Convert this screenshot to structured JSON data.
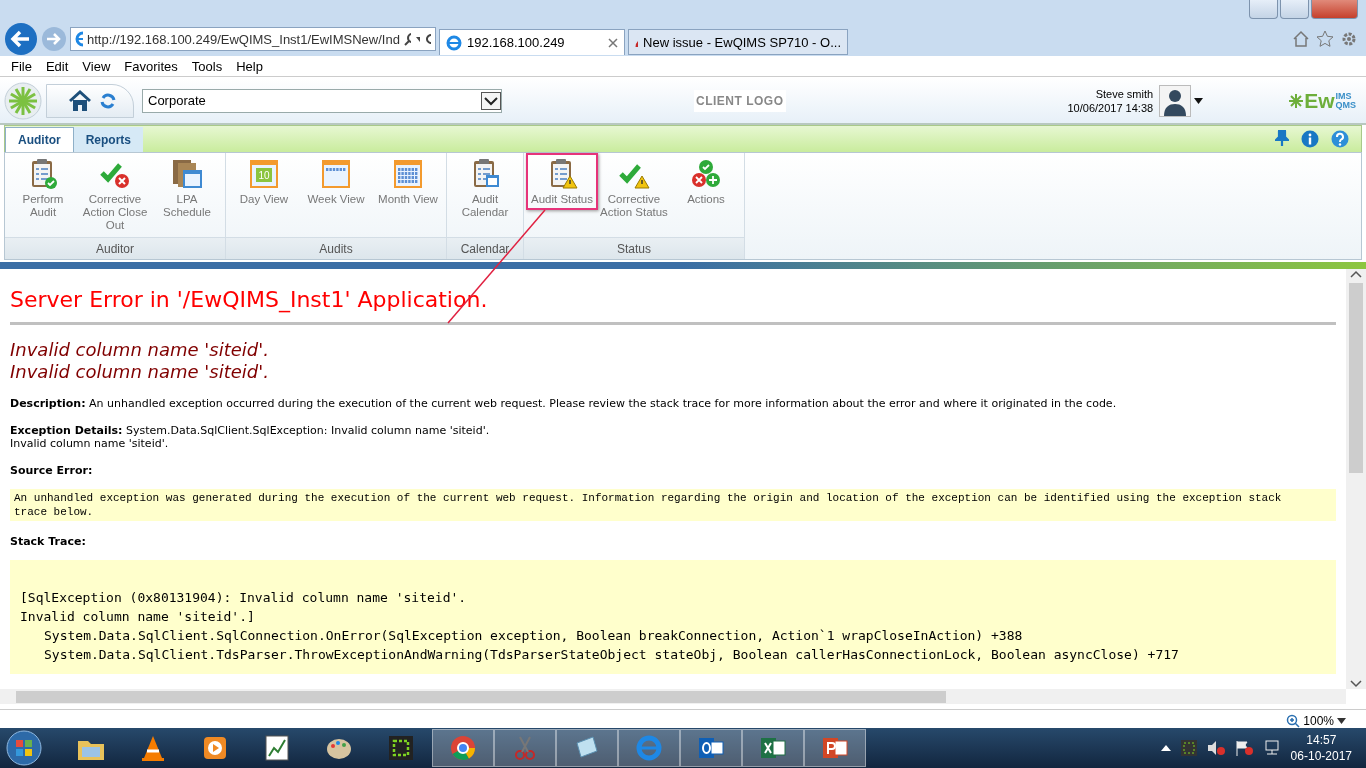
{
  "browser": {
    "address": "http://192.168.100.249/EwQIMS_Inst1/EwIMSNew/Ind",
    "tabs": [
      {
        "label": "192.168.100.249",
        "selected": true
      },
      {
        "label": "New issue - EwQIMS SP710 - O...",
        "selected": false
      }
    ],
    "menu": [
      "File",
      "Edit",
      "View",
      "Favorites",
      "Tools",
      "Help"
    ]
  },
  "app_header": {
    "site": "Corporate",
    "client_logo": "CLIENT LOGO",
    "user": "Steve smith",
    "datetime": "10/06/2017 14:38",
    "brand": {
      "main": "Ew",
      "top": "IMS",
      "bottom": "QMS"
    }
  },
  "ribbon": {
    "tabs": [
      {
        "label": "Auditor",
        "selected": true
      },
      {
        "label": "Reports",
        "selected": false
      }
    ],
    "groups": [
      {
        "label": "Auditor",
        "buttons": [
          {
            "label": "Perform Audit",
            "highlighted": false
          },
          {
            "label": "Corrective Action Close Out",
            "highlighted": false
          },
          {
            "label": "LPA Schedule",
            "highlighted": false
          }
        ]
      },
      {
        "label": "Audits",
        "buttons": [
          {
            "label": "Day View",
            "highlighted": false,
            "badge": "10"
          },
          {
            "label": "Week View",
            "highlighted": false
          },
          {
            "label": "Month View",
            "highlighted": false
          }
        ]
      },
      {
        "label": "Calendar",
        "buttons": [
          {
            "label": "Audit Calendar",
            "highlighted": false
          }
        ]
      },
      {
        "label": "Status",
        "buttons": [
          {
            "label": "Audit Status",
            "highlighted": true
          },
          {
            "label": "Corrective Action Status",
            "highlighted": false
          },
          {
            "label": "Actions",
            "highlighted": false
          }
        ]
      }
    ]
  },
  "error_page": {
    "title": "Server Error in '/EwQIMS_Inst1' Application.",
    "messages": [
      "Invalid column name 'siteid'.",
      "Invalid column name 'siteid'."
    ],
    "description": "**Description:** An unhandled exception occurred during the execution of the current web request. Please review the stack trace for more information about the error and where it originated in the code.",
    "exception_details": [
      "**Exception Details:** System.Data.SqlClient.SqlException: Invalid column name 'siteid'.",
      "Invalid column name 'siteid'."
    ],
    "source_error_heading": "Source Error:",
    "source_error": "An unhandled exception was generated during the execution of the current web request. Information regarding the origin and location of the exception can be identified using the exception stack trace below.",
    "stack_trace_heading": "Stack Trace:",
    "stack_trace": [
      {
        "kind": "message",
        "text": "[SqlException (0x80131904): Invalid column name 'siteid'."
      },
      {
        "kind": "message",
        "text": "Invalid column name 'siteid'.]"
      },
      {
        "kind": "frame",
        "text": "System.Data.SqlClient.SqlConnection.OnError(SqlException exception, Boolean breakConnection, Action`1 wrapCloseInAction) +388"
      },
      {
        "kind": "frame",
        "text": "System.Data.SqlClient.TdsParser.ThrowExceptionAndWarning(TdsParserStateObject stateObj, Boolean callerHasConnectionLock, Boolean asyncClose) +717"
      }
    ]
  },
  "status_bar": {
    "zoom": "100%"
  },
  "taskbar": {
    "time": "14:57",
    "date": "06-10-2017"
  }
}
